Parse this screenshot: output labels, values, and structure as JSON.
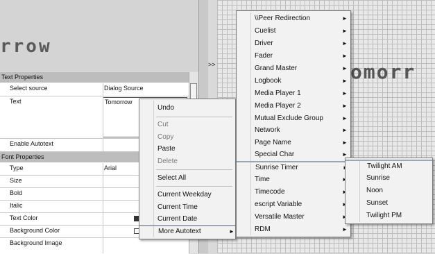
{
  "preview": {
    "text": "rrow"
  },
  "canvas": {
    "text": "omorr"
  },
  "splitter": {
    "collapse_glyph": ">>"
  },
  "grid": {
    "text_properties": {
      "title": "Text Properties",
      "rows": [
        {
          "label": "Select source",
          "value": "Dialog Source"
        },
        {
          "label": "Text",
          "value": "Tomorrow"
        },
        {
          "label": "Enable Autotext",
          "value": ""
        }
      ]
    },
    "font_properties": {
      "title": "Font Properties",
      "rows": [
        {
          "label": "Type",
          "value": "Arial"
        },
        {
          "label": "Size",
          "value": ""
        },
        {
          "label": "Bold",
          "value": ""
        },
        {
          "label": "Italic",
          "value": ""
        },
        {
          "label": "Text Color",
          "value": ""
        },
        {
          "label": "Background Color",
          "value": ""
        },
        {
          "label": "Background Image",
          "value": ""
        }
      ]
    }
  },
  "context_menu": {
    "items": [
      {
        "label": "Undo",
        "enabled": true
      },
      {
        "label": "Cut",
        "enabled": false
      },
      {
        "label": "Copy",
        "enabled": false
      },
      {
        "label": "Paste",
        "enabled": true
      },
      {
        "label": "Delete",
        "enabled": false
      },
      {
        "label": "Select All",
        "enabled": true
      },
      {
        "label": "Current Weekday",
        "enabled": true
      },
      {
        "label": "Current Time",
        "enabled": true
      },
      {
        "label": "Current Date",
        "enabled": true
      },
      {
        "label": "More Autotext",
        "enabled": true,
        "submenu": true
      }
    ]
  },
  "autotext_menu": {
    "items": [
      "\\\\Peer Redirection",
      "Cuelist",
      "Driver",
      "Fader",
      "Grand Master",
      "Logbook",
      "Media Player 1",
      "Media Player 2",
      "Mutual Exclude Group",
      "Network",
      "Page Name",
      "Special Char",
      "Sunrise Timer",
      "Time",
      "Timecode",
      "escript Variable",
      "Versatile Master",
      "RDM"
    ],
    "highlighted": "Sunrise Timer"
  },
  "sunrise_menu": {
    "items": [
      "Twilight AM",
      "Sunrise",
      "Noon",
      "Sunset",
      "Twilight PM"
    ],
    "highlighted": "Twilight AM"
  },
  "colors": {
    "text_color_swatch": "#333333",
    "background_color_swatch": "#ffffff"
  }
}
